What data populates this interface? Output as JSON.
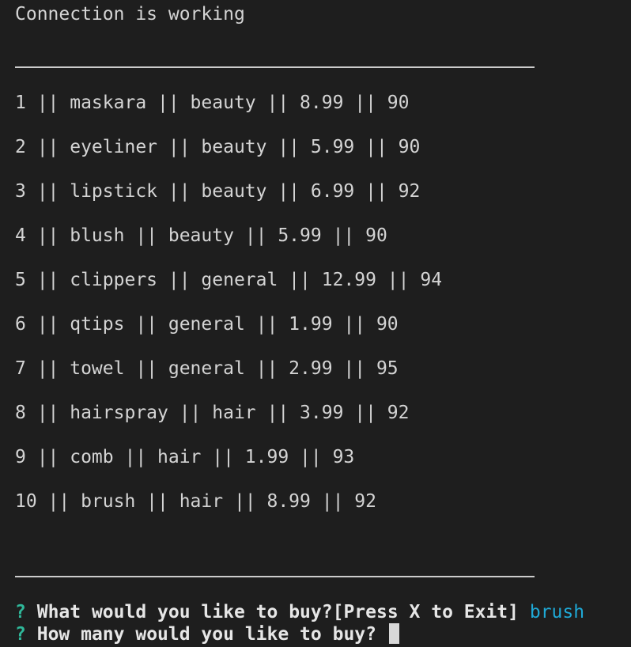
{
  "status": "Connection is working",
  "separator": "____________________________________________",
  "rows": [
    "1 || maskara || beauty || 8.99 || 90",
    "2 || eyeliner || beauty || 5.99 || 90",
    "3 || lipstick || beauty || 6.99 || 92",
    "4 || blush || beauty || 5.99 || 90",
    "5 || clippers || general || 12.99 || 94",
    "6 || qtips || general || 1.99 || 90",
    "7 || towel || general || 2.99 || 95",
    "8 || hairspray || hair || 3.99 || 92",
    "9 || comb || hair || 1.99 || 93",
    "10 || brush || hair || 8.99 || 92"
  ],
  "prompts": [
    {
      "mark": "?",
      "question": "What would you like to buy?[Press X to Exit]",
      "answer": "brush"
    },
    {
      "mark": "?",
      "question": "How many would you like to buy?",
      "answer": ""
    }
  ],
  "colors": {
    "background": "#1e1e1e",
    "text": "#d4d4d4",
    "prompt_mark": "#2fb89a",
    "answer": "#1fa9d6"
  }
}
